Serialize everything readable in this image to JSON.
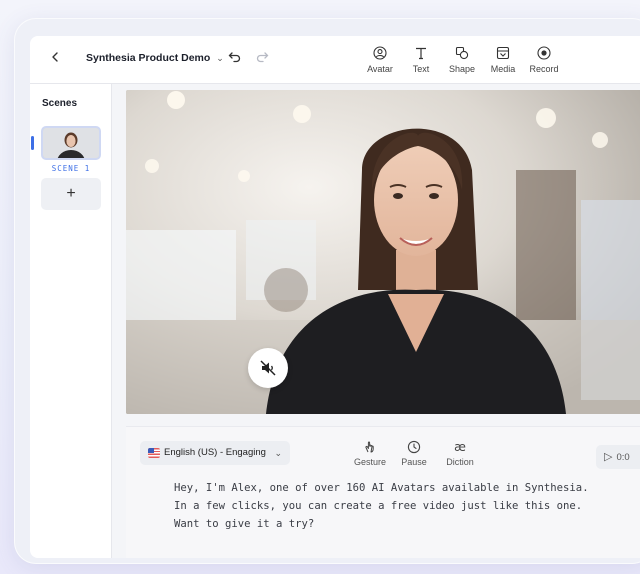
{
  "toolbar": {
    "project_title": "Synthesia Product Demo",
    "tools": [
      {
        "label": "Avatar",
        "icon": "avatar-icon"
      },
      {
        "label": "Text",
        "icon": "text-icon"
      },
      {
        "label": "Shape",
        "icon": "shape-icon"
      },
      {
        "label": "Media",
        "icon": "media-icon"
      },
      {
        "label": "Record",
        "icon": "record-icon"
      }
    ]
  },
  "sidebar": {
    "title": "Scenes",
    "scenes": [
      {
        "label": "SCENE 1"
      }
    ]
  },
  "panel": {
    "language": "English (US) - Engaging",
    "controls": [
      {
        "label": "Gesture",
        "icon": "gesture-icon"
      },
      {
        "label": "Pause",
        "icon": "clock-icon"
      },
      {
        "label": "Diction",
        "icon": "diction-icon"
      }
    ],
    "play_time": "0:0",
    "script_lines": [
      "Hey, I'm Alex, one of over 160 AI Avatars available in Synthesia.",
      "In a few clicks, you can create a free video just like this one.",
      "Want to give it a try?"
    ]
  },
  "colors": {
    "accent": "#3d6fe6",
    "background": "#eef0f7"
  }
}
